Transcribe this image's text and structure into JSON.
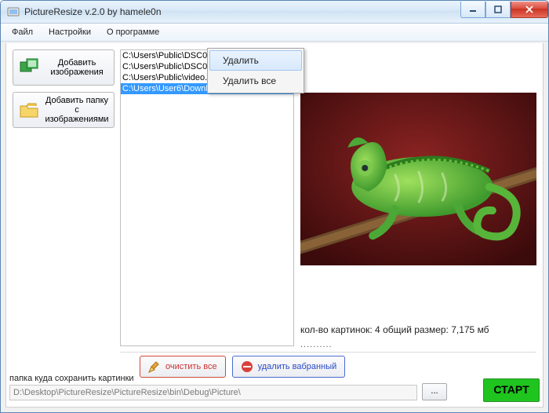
{
  "window": {
    "title": "PictureResize v.2.0        by hamele0n"
  },
  "menubar": {
    "items": [
      "Файл",
      "Настройки",
      "О программе"
    ]
  },
  "sidebar": {
    "add_images_btn": "Добавить изображения",
    "add_folder_btn": "Добавить папку с изображениями"
  },
  "filelist": {
    "items": [
      {
        "path": "C:\\Users\\Public\\DSC00010.JPG",
        "selected": false
      },
      {
        "path": "C:\\Users\\Public\\DSC00011.JPG",
        "selected": false
      },
      {
        "path": "C:\\Users\\Public\\video.jpg",
        "selected": false
      },
      {
        "path": "C:\\Users\\User6\\Downloads\\",
        "selected": true
      }
    ]
  },
  "context_menu": {
    "delete": "Удалить",
    "delete_all": "Удалить все"
  },
  "stats": {
    "text": "кол-во картинок: 4 общий размер: 7,175 мб",
    "dots": ".........."
  },
  "actions": {
    "clear_all": "очистить все",
    "delete_selected": "удалить вабранный"
  },
  "save": {
    "label": "папка куда сохранить картинки",
    "path_value": "D:\\Desktop\\PictureResize\\PictureResize\\bin\\Debug\\Picture\\",
    "browse_label": "...",
    "start_label": "СТАРТ"
  },
  "preview": {
    "description": "chameleon-on-branch"
  }
}
